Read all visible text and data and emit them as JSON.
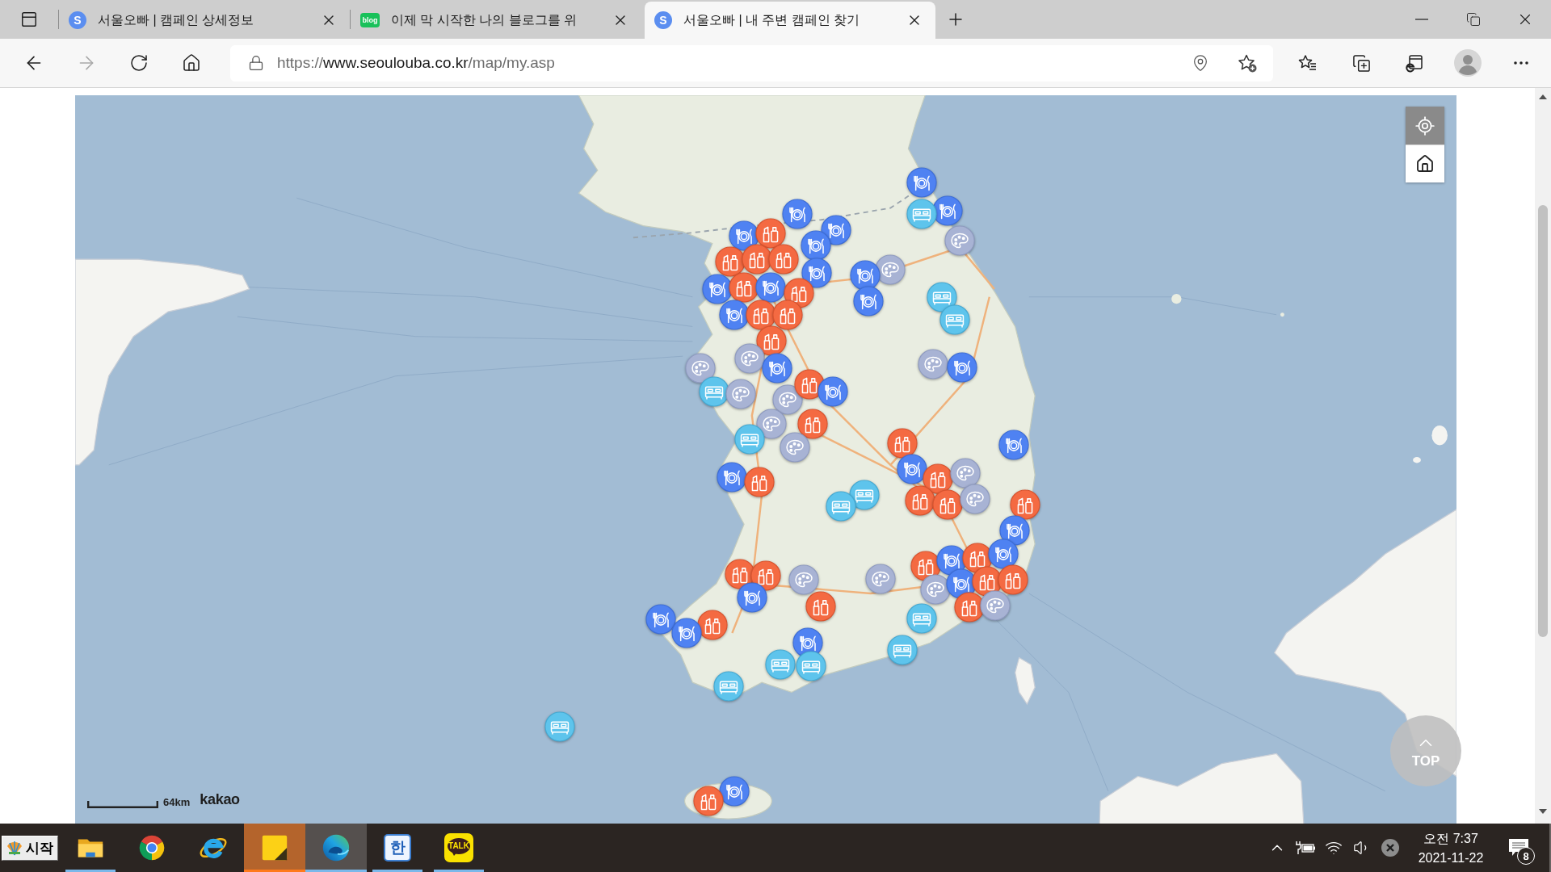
{
  "browser": {
    "tabs": [
      {
        "title": "서울오빠 | 캠페인 상세정보",
        "favicon": {
          "kind": "circle",
          "text": "S"
        },
        "selected": false
      },
      {
        "title": "이제 막 시작한 나의 블로그를 위",
        "favicon": {
          "kind": "bubble",
          "text": "blog"
        },
        "selected": false
      },
      {
        "title": "서울오빠 | 내 주변 캠페인 찾기",
        "favicon": {
          "kind": "circle",
          "text": "S"
        },
        "selected": true
      }
    ],
    "navigation": {
      "back_enabled": true,
      "forward_enabled": false
    },
    "address": {
      "scheme": "https://",
      "host": "www.seoulouba.co.kr",
      "path": "/map/my.asp"
    }
  },
  "map": {
    "scale_label": "64km",
    "provider": "kakao",
    "top_button": "TOP"
  },
  "taskbar": {
    "start": "시작",
    "apps": [
      {
        "kind": "explorer",
        "running": true,
        "selected": false,
        "attention": false
      },
      {
        "kind": "chrome",
        "running": false,
        "selected": false,
        "attention": false
      },
      {
        "kind": "ie",
        "running": false,
        "selected": false,
        "attention": false
      },
      {
        "kind": "sticky-notes",
        "running": true,
        "selected": false,
        "attention": true
      },
      {
        "kind": "edge",
        "running": true,
        "selected": true,
        "attention": false
      },
      {
        "kind": "hangul",
        "text": "한",
        "running": true,
        "selected": false,
        "attention": false
      },
      {
        "kind": "kakaotalk",
        "text": "TALK",
        "running": true,
        "selected": false,
        "attention": false
      }
    ],
    "clock": {
      "time": "오전 7:37",
      "date": "2021-11-22"
    },
    "notification_count": "8"
  }
}
